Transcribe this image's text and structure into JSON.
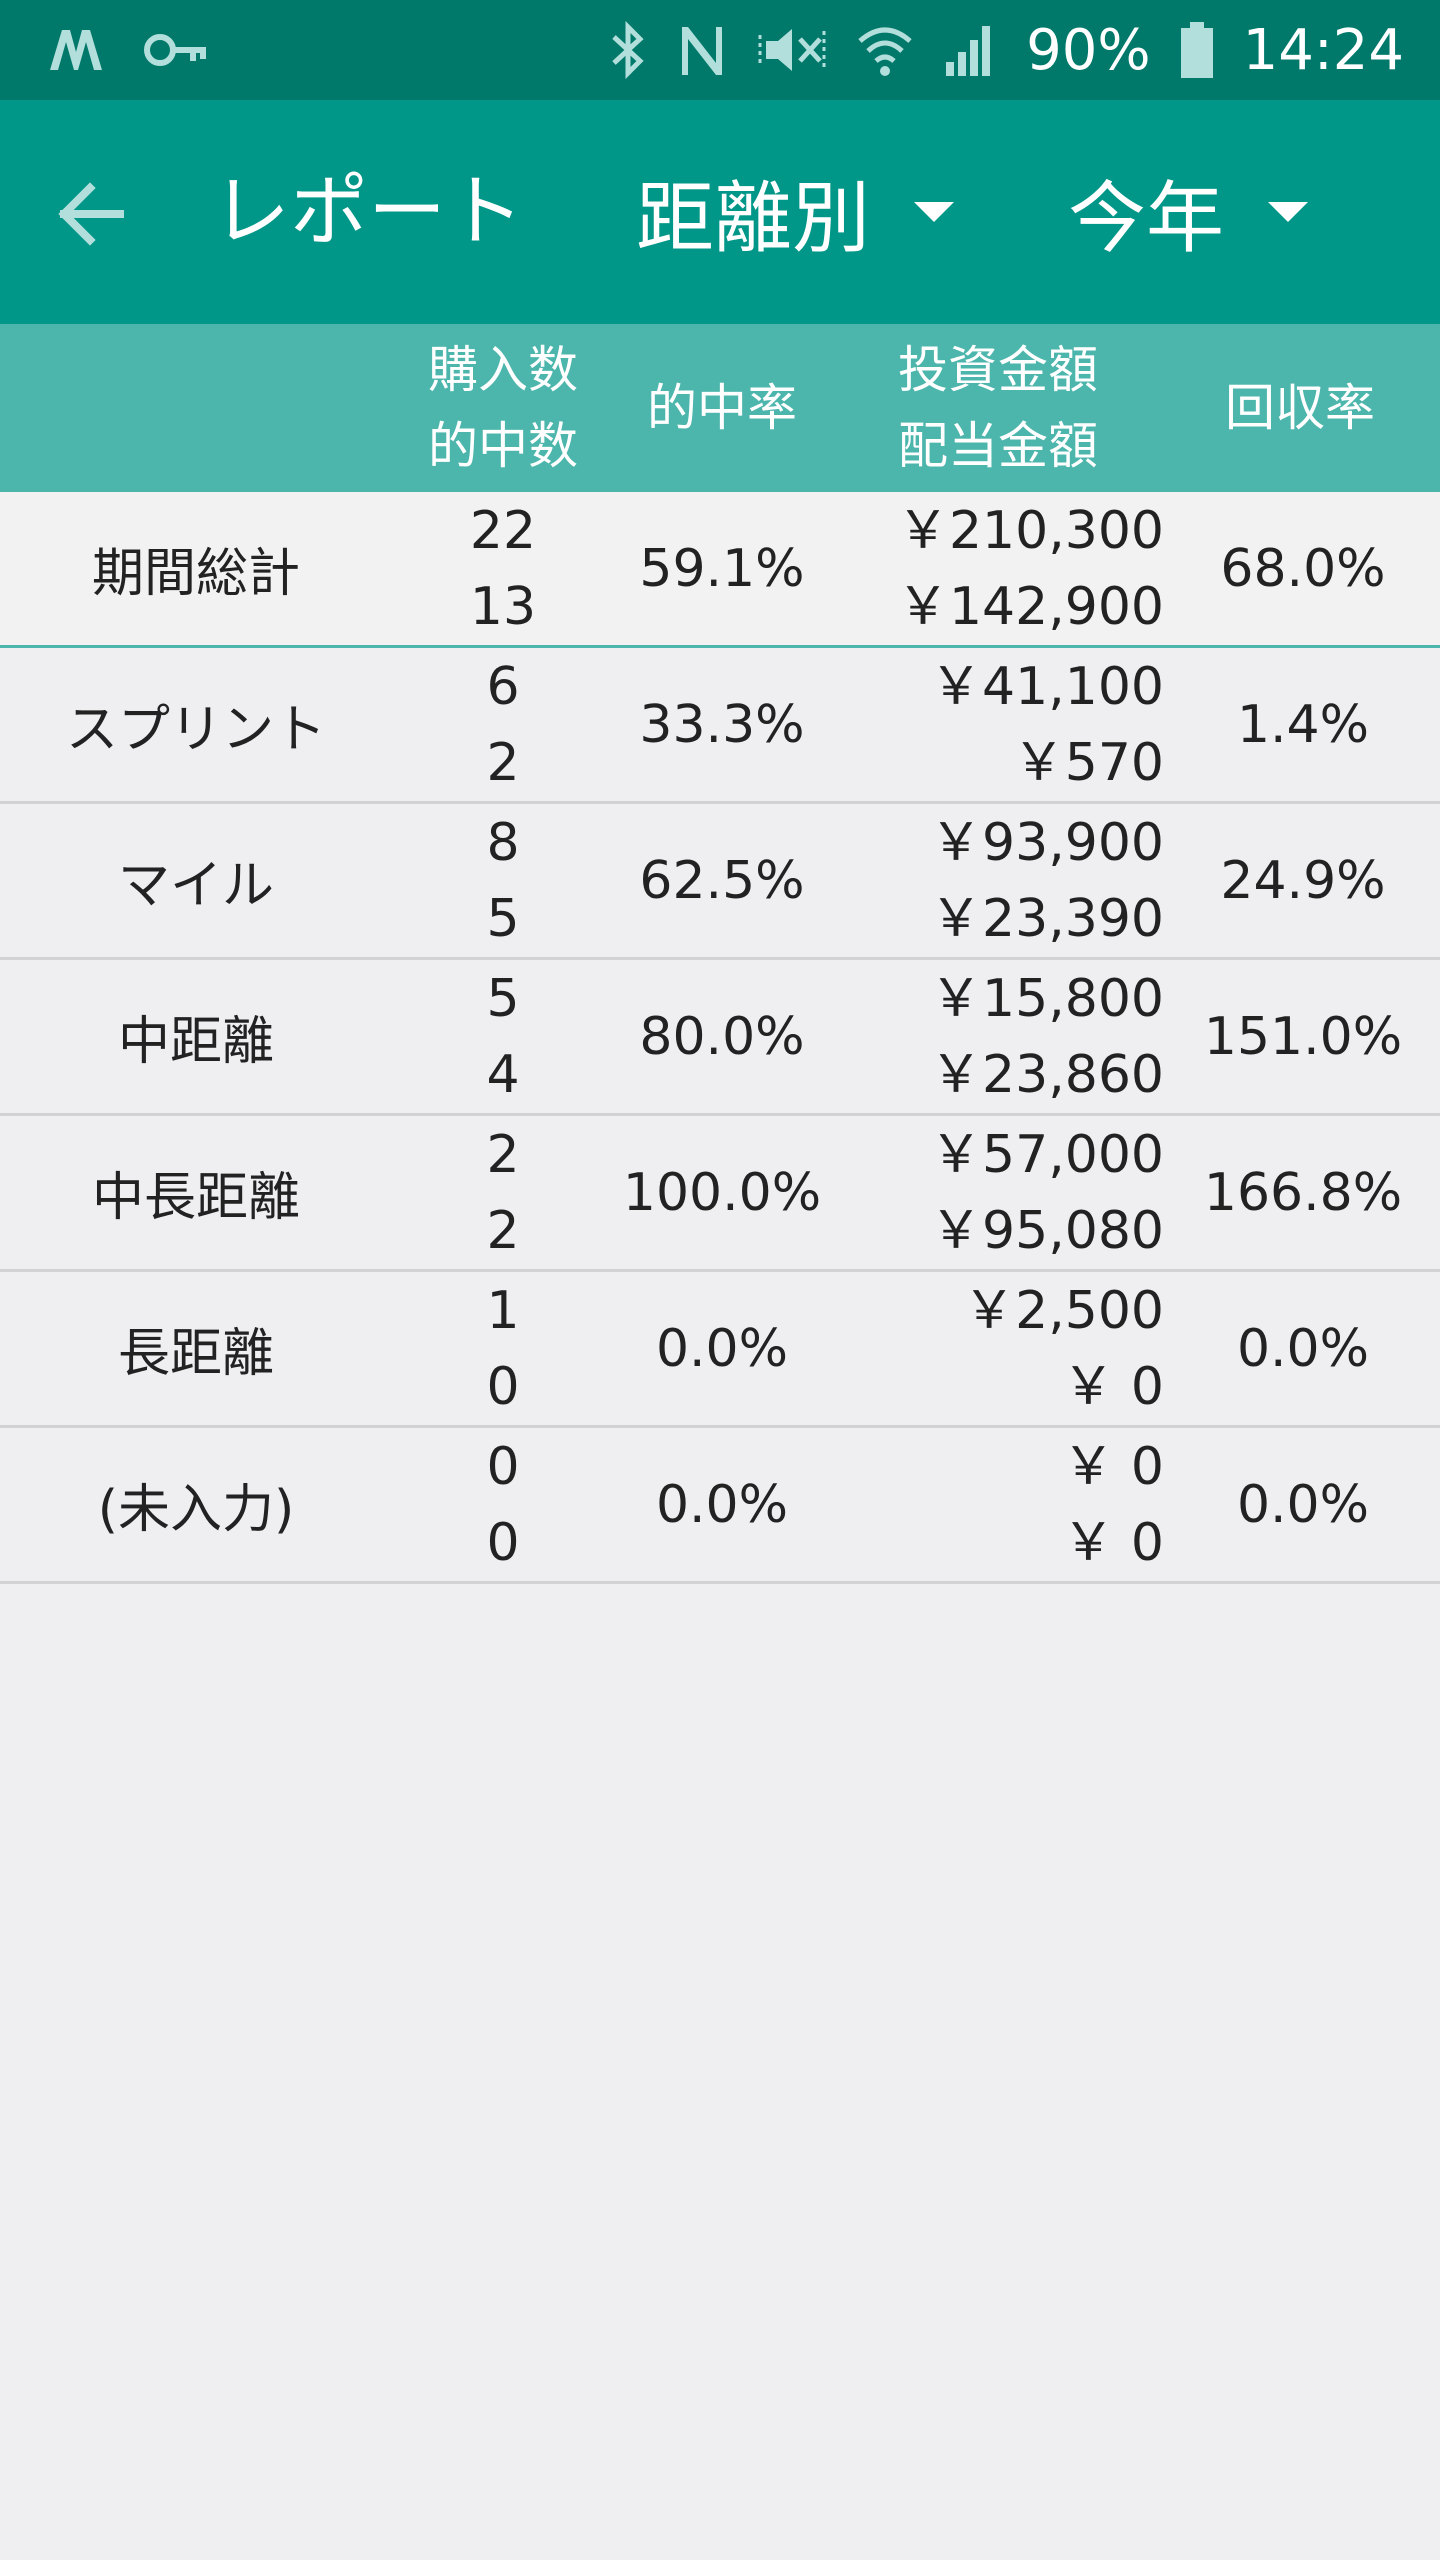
{
  "status_bar": {
    "left_icons": [
      "m-logo-icon",
      "key-icon"
    ],
    "right_icons": [
      "bluetooth-icon",
      "nfc-icon",
      "mute-icon",
      "wifi-icon",
      "signal-icon",
      "battery-icon"
    ],
    "battery_percent": "90%",
    "time": "14:24"
  },
  "app_bar": {
    "title": "レポート",
    "distance_filter": "距離別",
    "period_filter": "今年"
  },
  "table": {
    "headers": {
      "purchases": "購入数",
      "hits": "的中数",
      "hit_rate": "的中率",
      "investment": "投資金額",
      "payout": "配当金額",
      "return_rate": "回収率"
    },
    "rows": [
      {
        "name": "期間総計",
        "purchases": "22",
        "hits": "13",
        "hit_rate": "59.1%",
        "investment": "￥210,300",
        "payout": "￥142,900",
        "return_rate": "68.0%"
      },
      {
        "name": "スプリント",
        "purchases": "6",
        "hits": "2",
        "hit_rate": "33.3%",
        "investment": "￥41,100",
        "payout": "￥570",
        "return_rate": "1.4%"
      },
      {
        "name": "マイル",
        "purchases": "8",
        "hits": "5",
        "hit_rate": "62.5%",
        "investment": "￥93,900",
        "payout": "￥23,390",
        "return_rate": "24.9%"
      },
      {
        "name": "中距離",
        "purchases": "5",
        "hits": "4",
        "hit_rate": "80.0%",
        "investment": "￥15,800",
        "payout": "￥23,860",
        "return_rate": "151.0%"
      },
      {
        "name": "中長距離",
        "purchases": "2",
        "hits": "2",
        "hit_rate": "100.0%",
        "investment": "￥57,000",
        "payout": "￥95,080",
        "return_rate": "166.8%"
      },
      {
        "name": "長距離",
        "purchases": "1",
        "hits": "0",
        "hit_rate": "0.0%",
        "investment": "￥2,500",
        "payout": "￥ 0",
        "return_rate": "0.0%"
      },
      {
        "name": "(未入力)",
        "purchases": "0",
        "hits": "0",
        "hit_rate": "0.0%",
        "investment": "￥ 0",
        "payout": "￥ 0",
        "return_rate": "0.0%"
      }
    ]
  },
  "colors": {
    "status_bar": "#00796b",
    "app_bar": "#009688",
    "table_header": "#4db6ac",
    "background": "#efeef1"
  }
}
